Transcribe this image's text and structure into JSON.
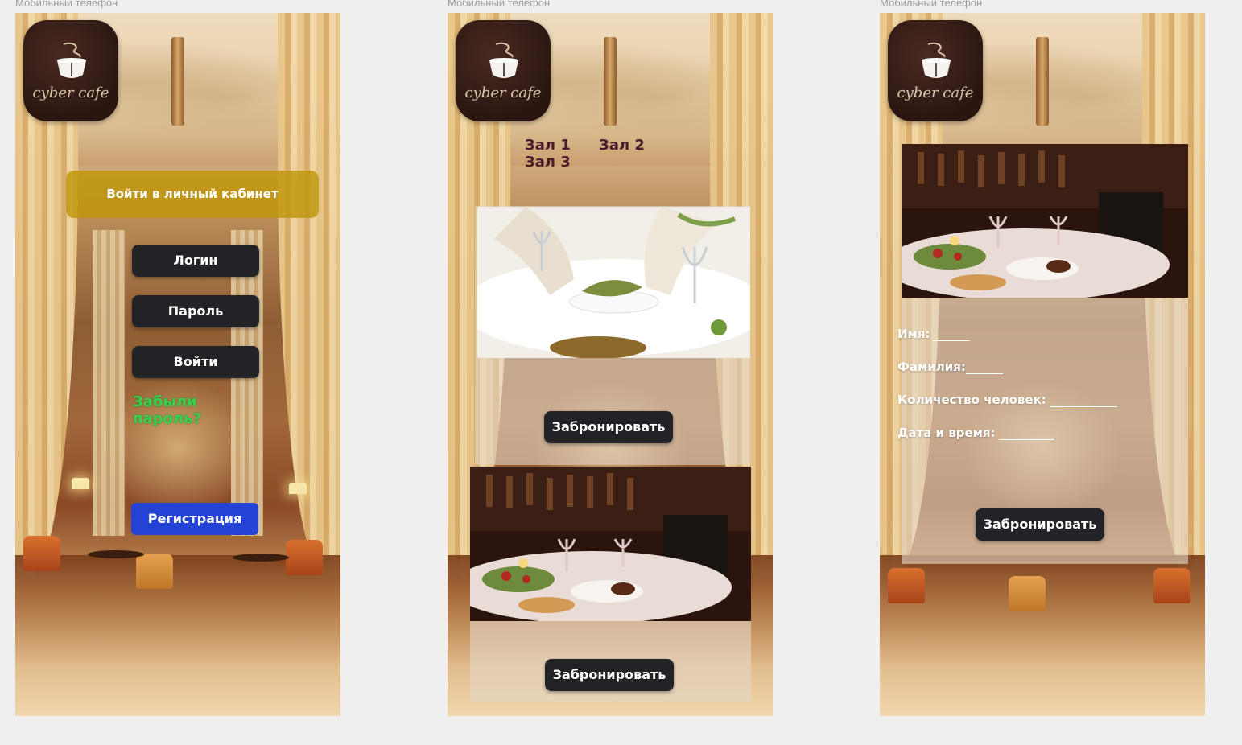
{
  "frames": [
    {
      "label": "Мобильный телефон"
    },
    {
      "label": "Мобильный телефон"
    },
    {
      "label": "Мобильный телефон"
    }
  ],
  "logo": {
    "text": "cyber cafe"
  },
  "screen1": {
    "banner": "Войти в личный кабинет",
    "login_label": "Логин",
    "password_label": "Пароль",
    "submit_label": "Войти",
    "forgot_label": "Забыли пароль?",
    "register_label": "Регистрация"
  },
  "screen2": {
    "tabs": [
      "Зал 1",
      "Зал 2",
      "Зал 3"
    ],
    "book_label_1": "Забронировать",
    "book_label_2": "Забронировать"
  },
  "screen3": {
    "fields": [
      {
        "label": "Имя:"
      },
      {
        "label": "Фамилия:"
      },
      {
        "label": "Количество человек:"
      },
      {
        "label": "Дата и время:"
      }
    ],
    "book_label": "Забронировать"
  },
  "colors": {
    "button_dark": "#212327",
    "register_blue": "#2342d6",
    "banner_gold": "#be960a",
    "forgot_green": "#3ccf4e",
    "tab_text": "#4b1b2e"
  }
}
